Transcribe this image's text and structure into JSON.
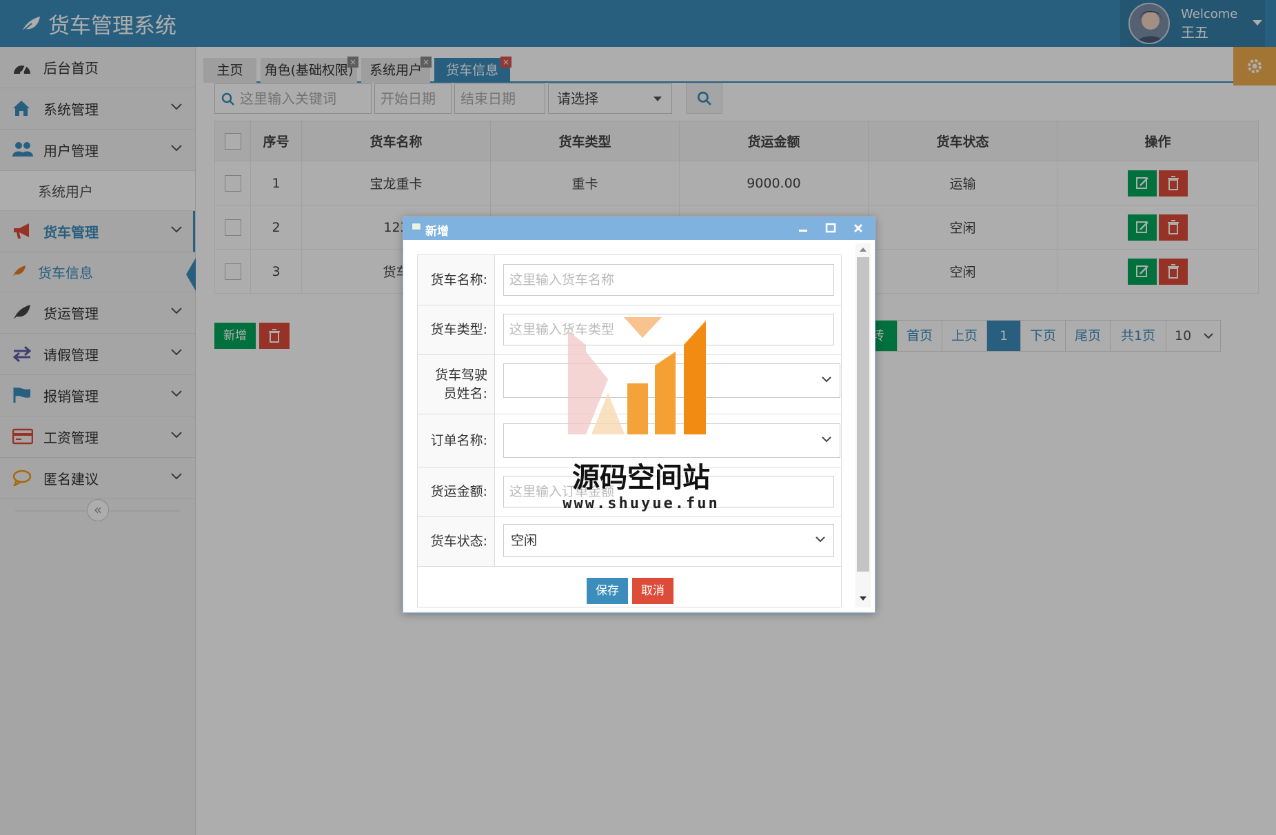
{
  "app": {
    "title": "货车管理系统"
  },
  "user": {
    "welcome": "Welcome",
    "name": "王五"
  },
  "sidebar": {
    "items": [
      {
        "label": "后台首页"
      },
      {
        "label": "系统管理"
      },
      {
        "label": "用户管理"
      },
      {
        "label": "系统用户"
      },
      {
        "label": "货车管理"
      },
      {
        "label": "货车信息"
      },
      {
        "label": "货运管理"
      },
      {
        "label": "请假管理"
      },
      {
        "label": "报销管理"
      },
      {
        "label": "工资管理"
      },
      {
        "label": "匿名建议"
      }
    ],
    "collapse_label": "«"
  },
  "tabs": [
    {
      "label": "主页"
    },
    {
      "label": "角色(基础权限)"
    },
    {
      "label": "系统用户"
    },
    {
      "label": "货车信息"
    }
  ],
  "toolbar": {
    "keyword_placeholder": "这里输入关键词",
    "start_date_placeholder": "开始日期",
    "end_date_placeholder": "结束日期",
    "select_value": "请选择"
  },
  "table": {
    "headers": [
      "序号",
      "货车名称",
      "货车类型",
      "货运金额",
      "货车状态",
      "操作"
    ],
    "rows": [
      {
        "no": "1",
        "name": "宝龙重卡",
        "type": "重卡",
        "amount": "9000.00",
        "status": "运输"
      },
      {
        "no": "2",
        "name": "123",
        "type": "",
        "amount": "",
        "status": "空闲"
      },
      {
        "no": "3",
        "name": "货车",
        "type": "",
        "amount": "",
        "status": "空闲"
      }
    ]
  },
  "actions": {
    "add_label": "新增"
  },
  "pager": {
    "partial_label": "转",
    "first": "首页",
    "prev": "上页",
    "current": "1",
    "next": "下页",
    "last": "尾页",
    "total": "共1页",
    "page_size": "10"
  },
  "dialog": {
    "title": "新增",
    "fields": {
      "name_label": "货车名称:",
      "name_placeholder": "这里输入货车名称",
      "type_label": "货车类型:",
      "type_placeholder": "这里输入货车类型",
      "driver_label_line1": "货车驾驶",
      "driver_label_line2": "员姓名:",
      "order_label": "订单名称:",
      "amount_label": "货运金额:",
      "amount_placeholder": "这里输入订单金额",
      "status_label": "货车状态:",
      "status_value": "空闲"
    },
    "save_label": "保存",
    "cancel_label": "取消"
  },
  "watermark": {
    "text": "源码空间站",
    "url": "www.shuyue.fun"
  },
  "colors": {
    "primary": "#3c8dbc",
    "success": "#00a65a",
    "danger": "#dd4b39",
    "warning": "#f0ad4e",
    "dialog_title": "#7fb2de"
  }
}
